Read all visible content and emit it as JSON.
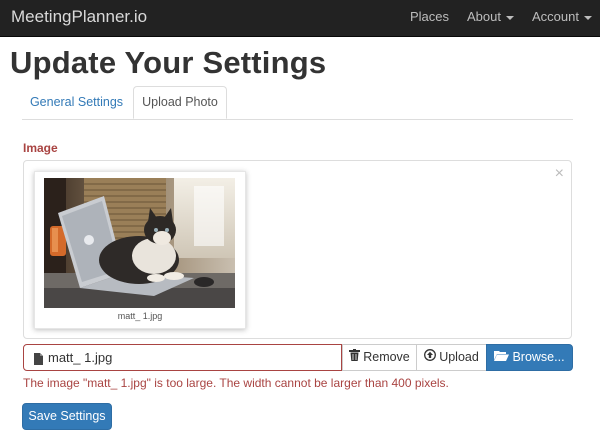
{
  "navbar": {
    "brand": "MeetingPlanner.io",
    "items": [
      {
        "label": "Places"
      },
      {
        "label": "About"
      },
      {
        "label": "Account"
      }
    ]
  },
  "page": {
    "title": "Update Your Settings"
  },
  "tabs": [
    {
      "label": "General Settings",
      "active": false
    },
    {
      "label": "Upload Photo",
      "active": true
    }
  ],
  "form": {
    "image_label": "Image",
    "close_symbol": "×",
    "thumbnail": {
      "caption": "matt_ 1.jpg"
    },
    "file_input": {
      "value": "matt_ 1.jpg"
    },
    "buttons": {
      "remove": "Remove",
      "upload": "Upload",
      "browse": "Browse..."
    },
    "error": "The image \"matt_ 1.jpg\" is too large. The width cannot be larger than 400 pixels.",
    "save": "Save Settings"
  },
  "colors": {
    "navbar": "#222222",
    "primary": "#337ab7",
    "error": "#a94442",
    "link": "#337ab7"
  },
  "icons": {
    "file": "file-icon",
    "trash": "trash-icon",
    "upload": "upload-circle-icon",
    "folder": "folder-open-icon",
    "caret": "caret-down-icon"
  }
}
